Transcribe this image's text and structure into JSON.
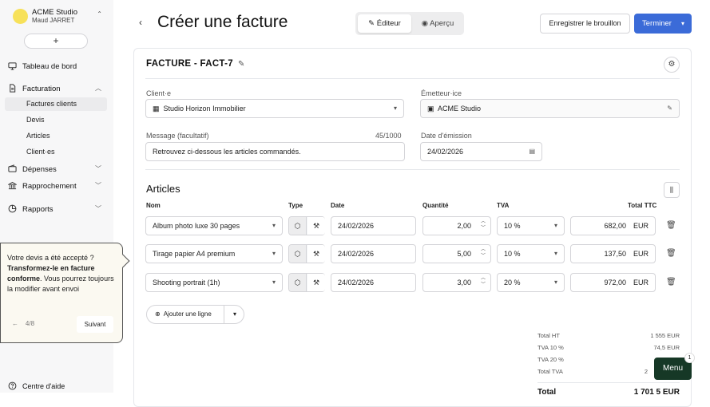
{
  "sidebar": {
    "org_name": "ACME Studio",
    "user_name": "Maud JARRET",
    "add_label": "+",
    "items": [
      {
        "label": "Tableau de bord"
      },
      {
        "label": "Facturation"
      },
      {
        "label": "Factures clients"
      },
      {
        "label": "Devis"
      },
      {
        "label": "Articles"
      },
      {
        "label": "Client·es"
      },
      {
        "label": "Dépenses"
      },
      {
        "label": "Rapprochement"
      },
      {
        "label": "Rapports"
      }
    ],
    "help_label": "Centre d'aide"
  },
  "tour": {
    "text_1": "Votre devis a été accepté ? ",
    "text_bold": "Transformez-le en facture conforme",
    "text_2": ". Vous pourrez toujours la modifier avant envoi",
    "step": "4/8",
    "next_label": "Suivant"
  },
  "header": {
    "title": "Créer une facture",
    "tab_editor": "Éditeur",
    "tab_preview": "Aperçu",
    "save_draft_label": "Enregistrer le brouillon",
    "finish_label": "Terminer"
  },
  "invoice": {
    "title": "FACTURE - FACT-7",
    "client_label": "Client·e",
    "client_value": "Studio Horizon Immobilier",
    "issuer_label": "Émetteur·ice",
    "issuer_value": "ACME Studio",
    "message_label": "Message (facultatif)",
    "message_count": "45/1000",
    "message_value": "Retrouvez ci-dessous les articles commandés.",
    "date_label": "Date d'émission",
    "date_value": "24/02/2026"
  },
  "articles": {
    "title": "Articles",
    "columns": [
      "Nom",
      "Type",
      "Date",
      "Quantité",
      "TVA",
      "Total TTC"
    ],
    "rows": [
      {
        "name": "Album photo luxe 30 pages",
        "date": "24/02/2026",
        "qty": "2,00",
        "vat": "10 %",
        "total": "682,00",
        "cur": "EUR"
      },
      {
        "name": "Tirage papier A4 premium",
        "date": "24/02/2026",
        "qty": "5,00",
        "vat": "10 %",
        "total": "137,50",
        "cur": "EUR"
      },
      {
        "name": "Shooting portrait (1h)",
        "date": "24/02/2026",
        "qty": "3,00",
        "vat": "20 %",
        "total": "972,00",
        "cur": "EUR"
      }
    ],
    "add_line_label": "Ajouter une ligne"
  },
  "totals": [
    {
      "label": "Total HT",
      "value": "1 555 EUR"
    },
    {
      "label": "TVA 10 %",
      "value": "74,5 EUR"
    },
    {
      "label": "TVA 20 %",
      "value": ""
    },
    {
      "label": "Total TVA",
      "value": "2"
    },
    {
      "label": "Total",
      "value": "1 701 5 EUR"
    }
  ],
  "menu": {
    "label": "Menu",
    "badge": "1"
  },
  "colors": {
    "accent": "#3b6bd8",
    "menu_bg": "#163826",
    "tour_bg": "#fbf9f1"
  }
}
